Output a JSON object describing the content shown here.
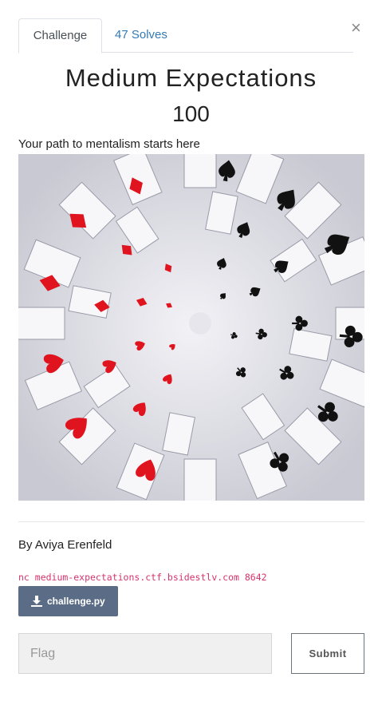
{
  "tabs": {
    "challenge": "Challenge",
    "solves": "47 Solves"
  },
  "close_glyph": "×",
  "challenge": {
    "name": "Medium Expectations",
    "points": "100",
    "description": "Your path to mentalism starts here",
    "image": "playing-cards-spiral-photo",
    "author": "By Aviya Erenfeld",
    "command": "nc medium-expectations.ctf.bsidestlv.com 8642",
    "file": "challenge.py"
  },
  "form": {
    "flag_placeholder": "Flag",
    "submit_label": "Submit"
  },
  "colors": {
    "link": "#337ab7",
    "code": "#d6336c",
    "download_button": "#5b6d86"
  }
}
